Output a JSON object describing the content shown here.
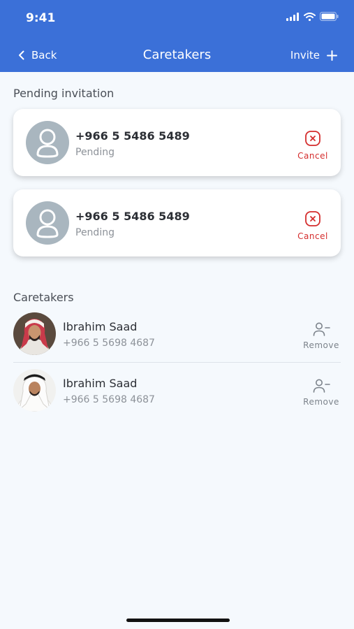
{
  "status_bar": {
    "time": "9:41"
  },
  "nav": {
    "back_label": "Back",
    "title": "Caretakers",
    "invite_label": "Invite"
  },
  "pending": {
    "title": "Pending invitation",
    "items": [
      {
        "phone": "+966 5 5486 5489",
        "status": "Pending",
        "action": "Cancel"
      },
      {
        "phone": "+966 5 5486 5489",
        "status": "Pending",
        "action": "Cancel"
      }
    ]
  },
  "caretakers": {
    "title": "Caretakers",
    "items": [
      {
        "name": "Ibrahim Saad",
        "phone": "+966 5 5698 4687",
        "action": "Remove"
      },
      {
        "name": "Ibrahim Saad",
        "phone": "+966 5 5698 4687",
        "action": "Remove"
      }
    ]
  },
  "colors": {
    "header": "#3b70d8",
    "cancel": "#d42d2d",
    "background": "#f5f9fd"
  }
}
